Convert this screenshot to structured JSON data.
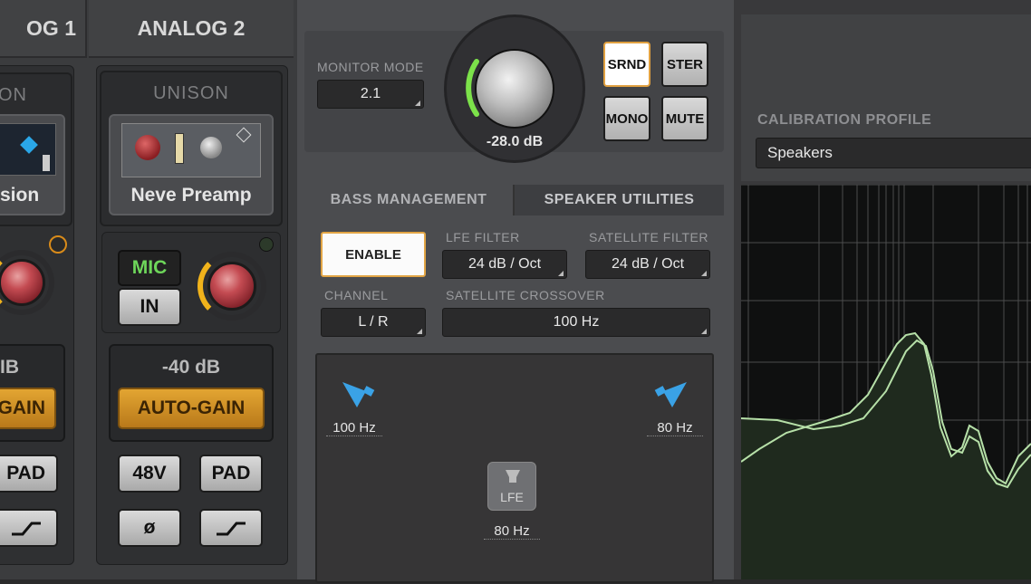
{
  "mixer": {
    "channels": [
      {
        "name": "OG 1",
        "unison_label": "ON",
        "plugin_name": "sion",
        "gain_value": "IB",
        "autogain_label": "GAIN",
        "pad_label": "PAD"
      },
      {
        "name": "ANALOG 2",
        "unison_label": "UNISON",
        "plugin_name": "Neve Preamp",
        "mic_label": "MIC",
        "in_label": "IN",
        "gain_value": "-40 dB",
        "autogain_label": "AUTO-GAIN",
        "phantom_label": "48V",
        "pad_label": "PAD",
        "phase_label": "ø"
      }
    ]
  },
  "monitor": {
    "mode_label": "MONITOR MODE",
    "mode_value": "2.1",
    "volume_value": "-28.0 dB",
    "buttons": {
      "srnd": "SRND",
      "ster": "STER",
      "mono": "MONO",
      "mute": "MUTE"
    }
  },
  "tabs": {
    "bass_management": "BASS MANAGEMENT",
    "speaker_utilities": "SPEAKER UTILITIES"
  },
  "bass": {
    "enable_label": "ENABLE",
    "lfe_filter_label": "LFE FILTER",
    "lfe_filter_value": "24 dB / Oct",
    "satellite_filter_label": "SATELLITE FILTER",
    "satellite_filter_value": "24 dB / Oct",
    "channel_label": "CHANNEL",
    "channel_value": "L / R",
    "crossover_label": "SATELLITE CROSSOVER",
    "crossover_value": "100 Hz"
  },
  "visualizer": {
    "left_freq": "100 Hz",
    "right_freq": "80 Hz",
    "lfe_label": "LFE",
    "lfe_freq": "80 Hz"
  },
  "calibration": {
    "label": "CALIBRATION PROFILE",
    "value": "Speakers"
  },
  "colors": {
    "accent_orange": "#e2a545",
    "meter_green": "#7ce24a",
    "speaker_blue": "#3aa2e6",
    "curve_green": "#b6e0a8",
    "channel_blue": "#1e5e9c"
  }
}
